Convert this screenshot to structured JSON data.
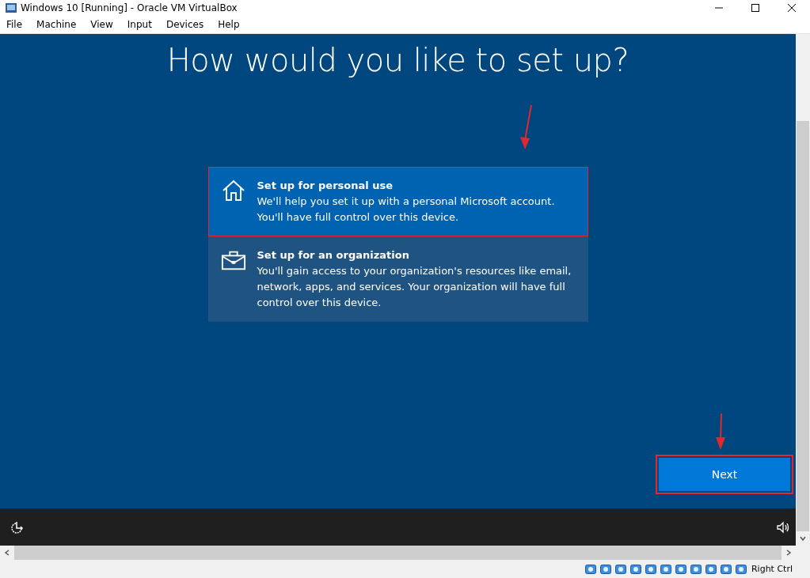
{
  "window": {
    "title": "Windows 10 [Running] - Oracle VM VirtualBox"
  },
  "menu": [
    "File",
    "Machine",
    "View",
    "Input",
    "Devices",
    "Help"
  ],
  "setup": {
    "heading": "How would you like to set up?",
    "options": [
      {
        "kind": "home",
        "title": "Set up for personal use",
        "description": "We'll help you set it up with a personal Microsoft account. You'll have full control over this device.",
        "selected": true
      },
      {
        "kind": "work",
        "title": "Set up for an organization",
        "description": "You'll gain access to your organization's resources like email, network, apps, and services. Your organization will have full control over this device.",
        "selected": false
      }
    ],
    "next_button": "Next"
  },
  "status_bar": {
    "host_key": "Right Ctrl"
  }
}
